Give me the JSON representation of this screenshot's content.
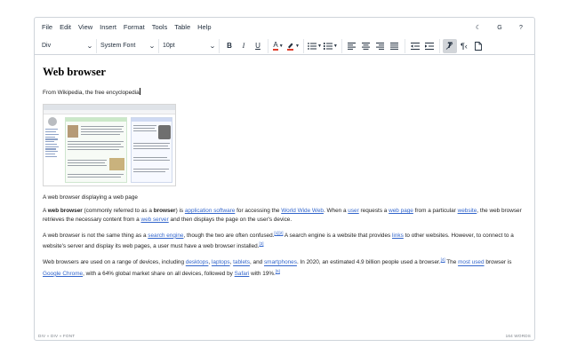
{
  "menubar": {
    "items": [
      "File",
      "Edit",
      "View",
      "Insert",
      "Format",
      "Tools",
      "Table",
      "Help"
    ],
    "right": [
      {
        "icon": "moon-icon",
        "glyph": "☾"
      },
      {
        "icon": "g-icon",
        "glyph": "G"
      },
      {
        "icon": "help-icon",
        "glyph": "?"
      }
    ]
  },
  "toolbar": {
    "block_format": "Div",
    "font_family": "System Font",
    "font_size": "10pt",
    "bold": "B",
    "italic": "I",
    "underline": "U",
    "text_color": "A",
    "accent_color": "#e03e2d"
  },
  "document": {
    "title": "Web browser",
    "subtitle": "From Wikipedia, the free encyclopedia",
    "caption": "A web browser displaying a web page",
    "p1": [
      {
        "t": "A "
      },
      {
        "b": "web browser"
      },
      {
        "t": " (commonly referred to as a "
      },
      {
        "b": "browser"
      },
      {
        "t": ") is "
      },
      {
        "a": "application software"
      },
      {
        "t": " for accessing the "
      },
      {
        "a": "World Wide Web"
      },
      {
        "t": ". When a "
      },
      {
        "a": "user"
      },
      {
        "t": " requests a "
      },
      {
        "a": "web page"
      },
      {
        "t": " from a particular "
      },
      {
        "a": "website"
      },
      {
        "t": ", the web browser retrieves the necessary content from a "
      },
      {
        "a": "web server"
      },
      {
        "t": " and then displays the page on the user's device."
      }
    ],
    "p2": [
      {
        "t": "A web browser is not the same thing as a "
      },
      {
        "a": "search engine"
      },
      {
        "t": ", though the two are often confused."
      },
      {
        "s": "[1]"
      },
      {
        "s": "[2]"
      },
      {
        "t": " A search engine is a website that provides "
      },
      {
        "a": "links"
      },
      {
        "t": " to other websites. However, to connect to a website's server and display its web pages, a user must have a web browser installed."
      },
      {
        "s": "[3]"
      }
    ],
    "p3": [
      {
        "t": "Web browsers are used on a range of devices, including "
      },
      {
        "a": "desktops"
      },
      {
        "t": ", "
      },
      {
        "a": "laptops"
      },
      {
        "t": ", "
      },
      {
        "a": "tablets"
      },
      {
        "t": ", and "
      },
      {
        "a": "smartphones"
      },
      {
        "t": ". In 2020, an estimated 4.9 billion people used a browser."
      },
      {
        "s": "[4]"
      },
      {
        "t": " The "
      },
      {
        "a": "most used"
      },
      {
        "t": " browser is "
      },
      {
        "a": "Google Chrome"
      },
      {
        "t": ", with a 64% global market share on all devices, followed by "
      },
      {
        "a": "Safari"
      },
      {
        "t": " with 19%."
      },
      {
        "s": "[5]"
      }
    ]
  },
  "statusbar": {
    "path": "DIV » DIV » FONT",
    "wordcount": "164 WORDS"
  }
}
